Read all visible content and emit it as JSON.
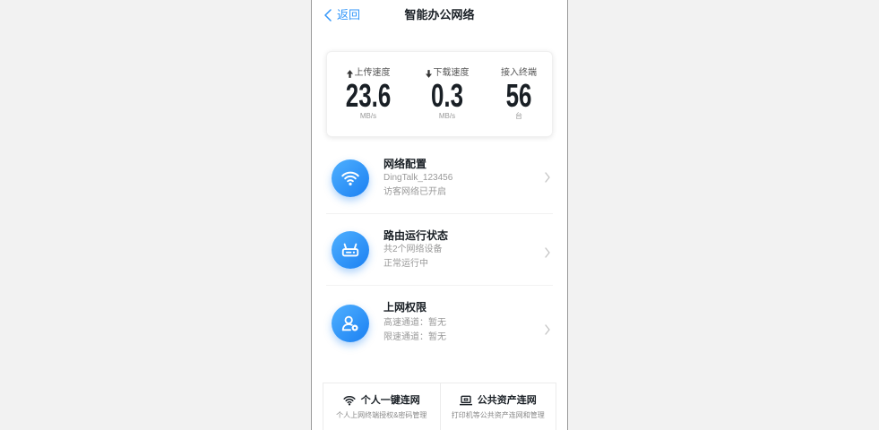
{
  "header": {
    "back_label": "返回",
    "title": "智能办公网络"
  },
  "stats": [
    {
      "icon": "arrow-up-icon",
      "label": "上传速度",
      "value": "23.6",
      "unit": "MB/s"
    },
    {
      "icon": "arrow-down-icon",
      "label": "下载速度",
      "value": "0.3",
      "unit": "MB/s"
    },
    {
      "label": "接入终端",
      "value": "56",
      "unit": "台"
    }
  ],
  "menu": [
    {
      "icon": "wifi-icon",
      "title": "网络配置",
      "line1": "DingTalk_123456",
      "line2": "访客网络已开启",
      "trailing_icon": "chevron-right-icon"
    },
    {
      "icon": "router-icon",
      "title": "路由运行状态",
      "line1": "共2个网络设备",
      "line2": "正常运行中",
      "trailing_icon": "chevron-right-icon"
    },
    {
      "icon": "user-permission-icon",
      "title": "上网权限",
      "line1": "高速通道：暂无",
      "line2": "限速通道：暂无",
      "trailing_icon": "chevron-right-icon"
    }
  ],
  "shortcuts": [
    {
      "icon": "wifi-icon",
      "title": "个人一键连网",
      "desc": "个人上网终端授权&密码管理"
    },
    {
      "icon": "laptop-icon",
      "title": "公共资产连网",
      "desc": "打印机等公共资产连网和管理"
    }
  ],
  "colors": {
    "accent": "#3296fa",
    "icon_gradient_start": "#4fb0ff",
    "icon_gradient_end": "#1b80f2",
    "text_primary": "#191f25",
    "text_secondary": "#999999",
    "page_background": "#f2f2f2"
  }
}
